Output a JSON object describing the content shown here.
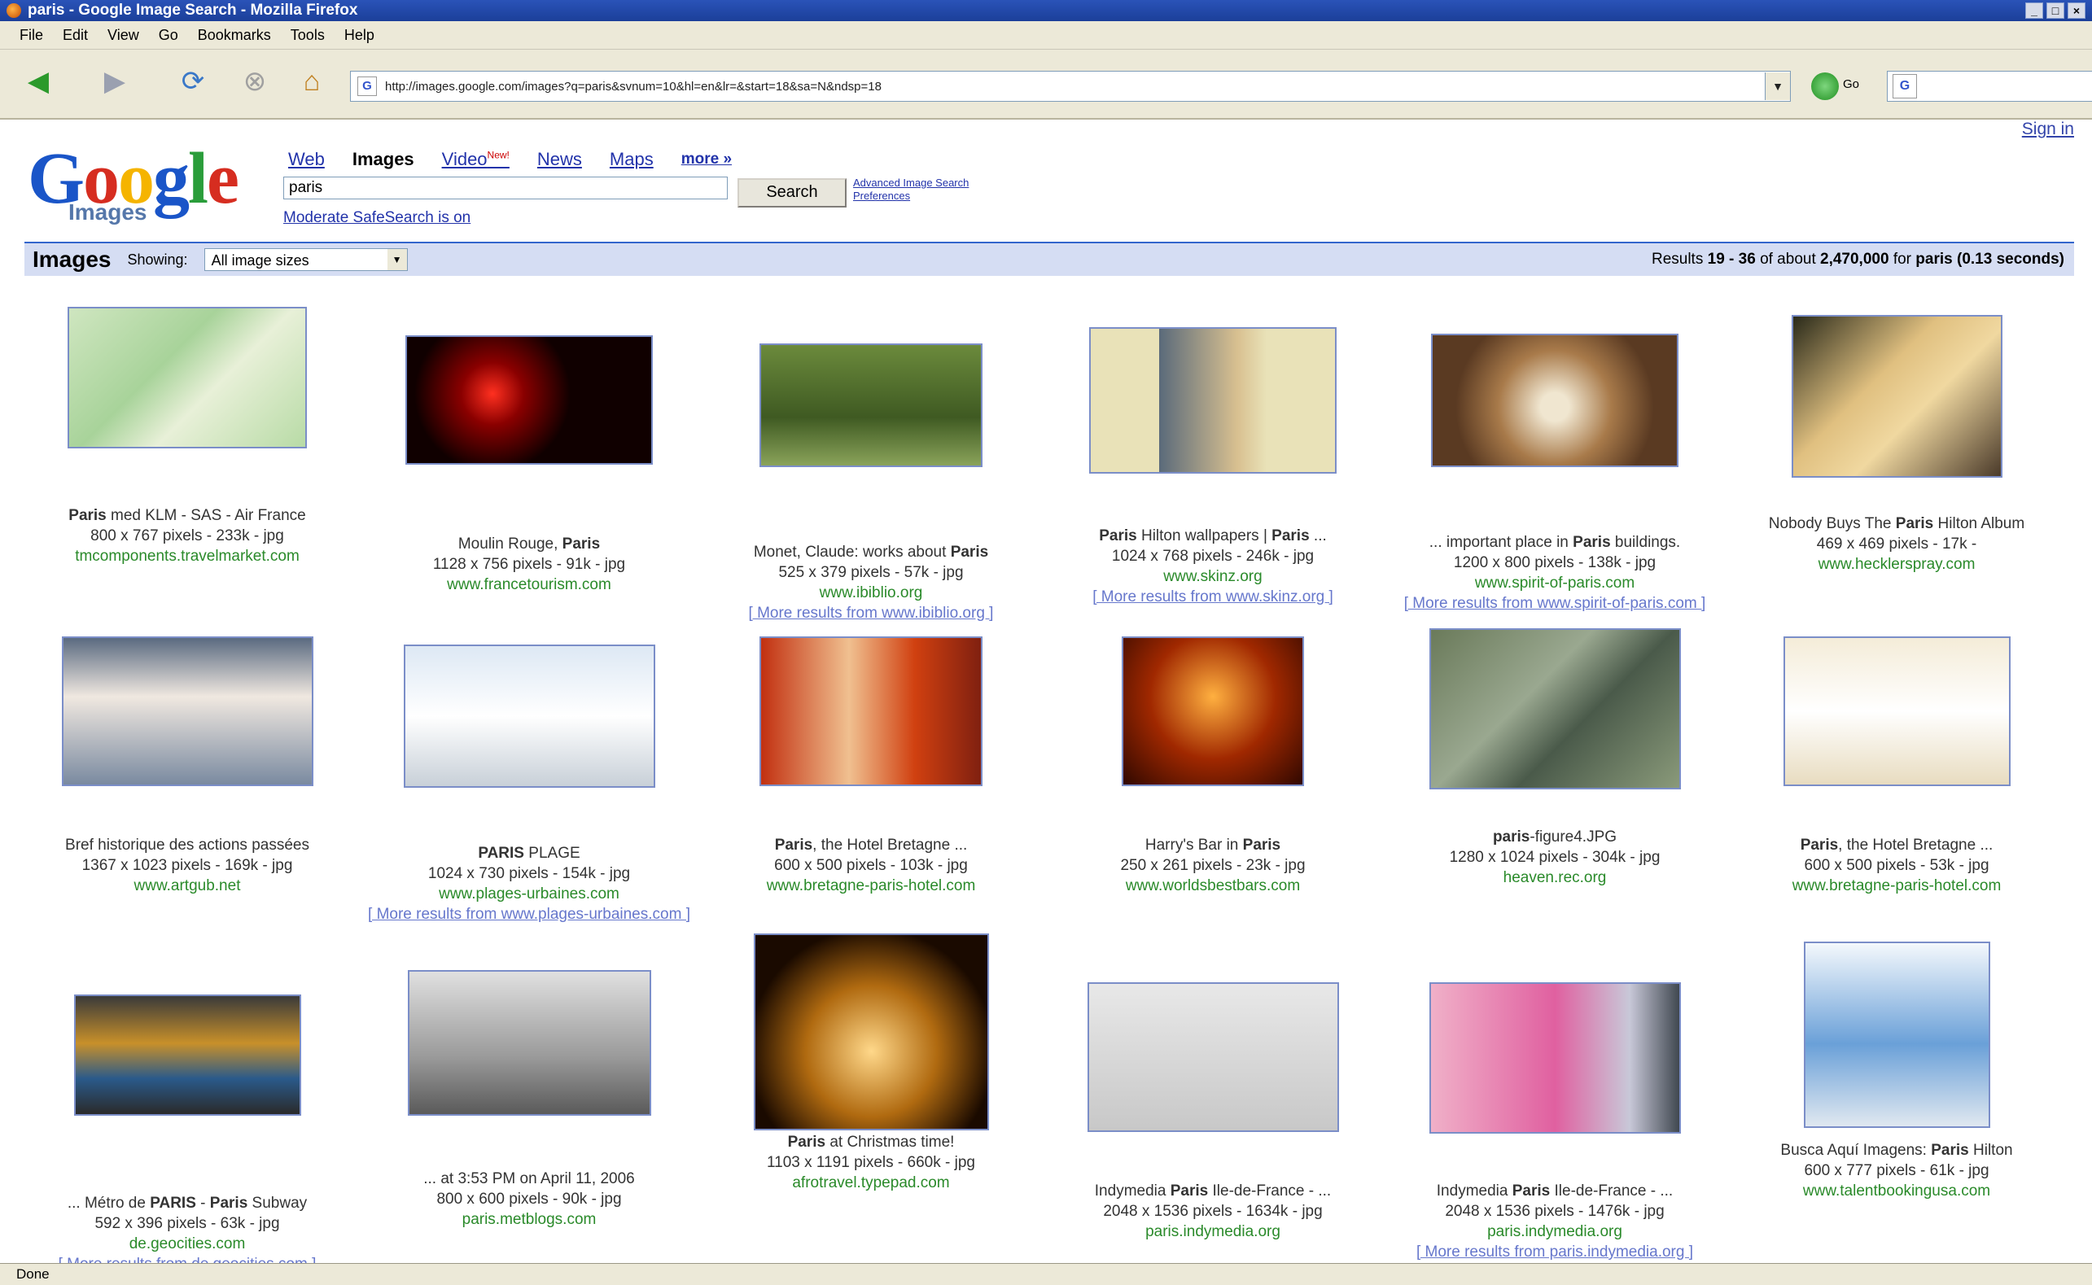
{
  "window": {
    "title": "paris - Google Image Search - Mozilla Firefox"
  },
  "menu": [
    "File",
    "Edit",
    "View",
    "Go",
    "Bookmarks",
    "Tools",
    "Help"
  ],
  "nav": {
    "url": "http://images.google.com/images?q=paris&svnum=10&hl=en&lr=&start=18&sa=N&ndsp=18",
    "go_label": "Go",
    "search_engine_letter": "G"
  },
  "header": {
    "sign_in": "Sign in",
    "logo_word": "Google",
    "logo_sub": "Images",
    "tabs": [
      {
        "label": "Web"
      },
      {
        "label": "Images"
      },
      {
        "label": "Video",
        "badge": "New!"
      },
      {
        "label": "News"
      },
      {
        "label": "Maps"
      },
      {
        "label": "more »"
      }
    ],
    "query": "paris",
    "search_label": "Search",
    "advanced_search": "Advanced Image Search",
    "preferences": "Preferences",
    "safesearch": "Moderate SafeSearch is on"
  },
  "bar": {
    "title": "Images",
    "showing_label": "Showing:",
    "size_select": "All image sizes",
    "results_prefix": "Results",
    "results_range": "19 - 36",
    "results_mid": "of about",
    "results_count": "2,470,000",
    "results_for": "for",
    "results_query": "paris",
    "results_time": "(0.13 seconds)"
  },
  "results": [
    {
      "caption": "Paris med KLM - SAS - Air France",
      "dims": "800 x 767 pixels - 233k - jpg",
      "domain": "tmcomponents.travelmarket.com",
      "more": ""
    },
    {
      "caption": "Moulin Rouge, Paris",
      "dims": "1128 x 756 pixels - 91k - jpg",
      "domain": "www.francetourism.com",
      "more": ""
    },
    {
      "caption": "Monet, Claude: works about Paris",
      "dims": "525 x 379 pixels - 57k - jpg",
      "domain": "www.ibiblio.org",
      "more": "[ More results from www.ibiblio.org ]"
    },
    {
      "caption": "Paris Hilton wallpapers | Paris ...",
      "dims": "1024 x 768 pixels - 246k - jpg",
      "domain": "www.skinz.org",
      "more": "[ More results from www.skinz.org ]"
    },
    {
      "caption": "... important place in Paris buildings.",
      "dims": "1200 x 800 pixels - 138k - jpg",
      "domain": "www.spirit-of-paris.com",
      "more": "[ More results from www.spirit-of-paris.com ]"
    },
    {
      "caption": "Nobody Buys The Paris Hilton Album",
      "dims": "469 x 469 pixels - 17k -",
      "domain": "www.hecklerspray.com",
      "more": ""
    },
    {
      "caption": "Bref historique des actions passées",
      "dims": "1367 x 1023 pixels - 169k - jpg",
      "domain": "www.artgub.net",
      "more": ""
    },
    {
      "caption": "PARIS PLAGE",
      "dims": "1024 x 730 pixels - 154k - jpg",
      "domain": "www.plages-urbaines.com",
      "more": "[ More results from www.plages-urbaines.com ]"
    },
    {
      "caption": "Paris, the Hotel Bretagne ...",
      "dims": "600 x 500 pixels - 103k - jpg",
      "domain": "www.bretagne-paris-hotel.com",
      "more": ""
    },
    {
      "caption": "Harry's Bar in Paris",
      "dims": "250 x 261 pixels - 23k - jpg",
      "domain": "www.worldsbestbars.com",
      "more": ""
    },
    {
      "caption": "paris-figure4.JPG",
      "dims": "1280 x 1024 pixels - 304k - jpg",
      "domain": "heaven.rec.org",
      "more": ""
    },
    {
      "caption": "Paris, the Hotel Bretagne ...",
      "dims": "600 x 500 pixels - 53k - jpg",
      "domain": "www.bretagne-paris-hotel.com",
      "more": ""
    },
    {
      "caption": "... Métro de PARIS - Paris Subway",
      "dims": "592 x 396 pixels - 63k - jpg",
      "domain": "de.geocities.com",
      "more": "[ More results from de.geocities.com ]"
    },
    {
      "caption": "... at 3:53 PM on April 11, 2006",
      "dims": "800 x 600 pixels - 90k - jpg",
      "domain": "paris.metblogs.com",
      "more": ""
    },
    {
      "caption": "Paris at Christmas time!",
      "dims": "1103 x 1191 pixels - 660k - jpg",
      "domain": "afrotravel.typepad.com",
      "more": ""
    },
    {
      "caption": "Indymedia Paris Ile-de-France - ...",
      "dims": "2048 x 1536 pixels - 1634k - jpg",
      "domain": "paris.indymedia.org",
      "more": ""
    },
    {
      "caption": "Indymedia Paris Ile-de-France - ...",
      "dims": "2048 x 1536 pixels - 1476k - jpg",
      "domain": "paris.indymedia.org",
      "more": "[ More results from paris.indymedia.org ]"
    },
    {
      "caption": "Busca Aquí Imagens: Paris Hilton",
      "dims": "600 x 777 pixels - 61k - jpg",
      "domain": "www.talentbookingusa.com",
      "more": ""
    }
  ],
  "status": "Done"
}
